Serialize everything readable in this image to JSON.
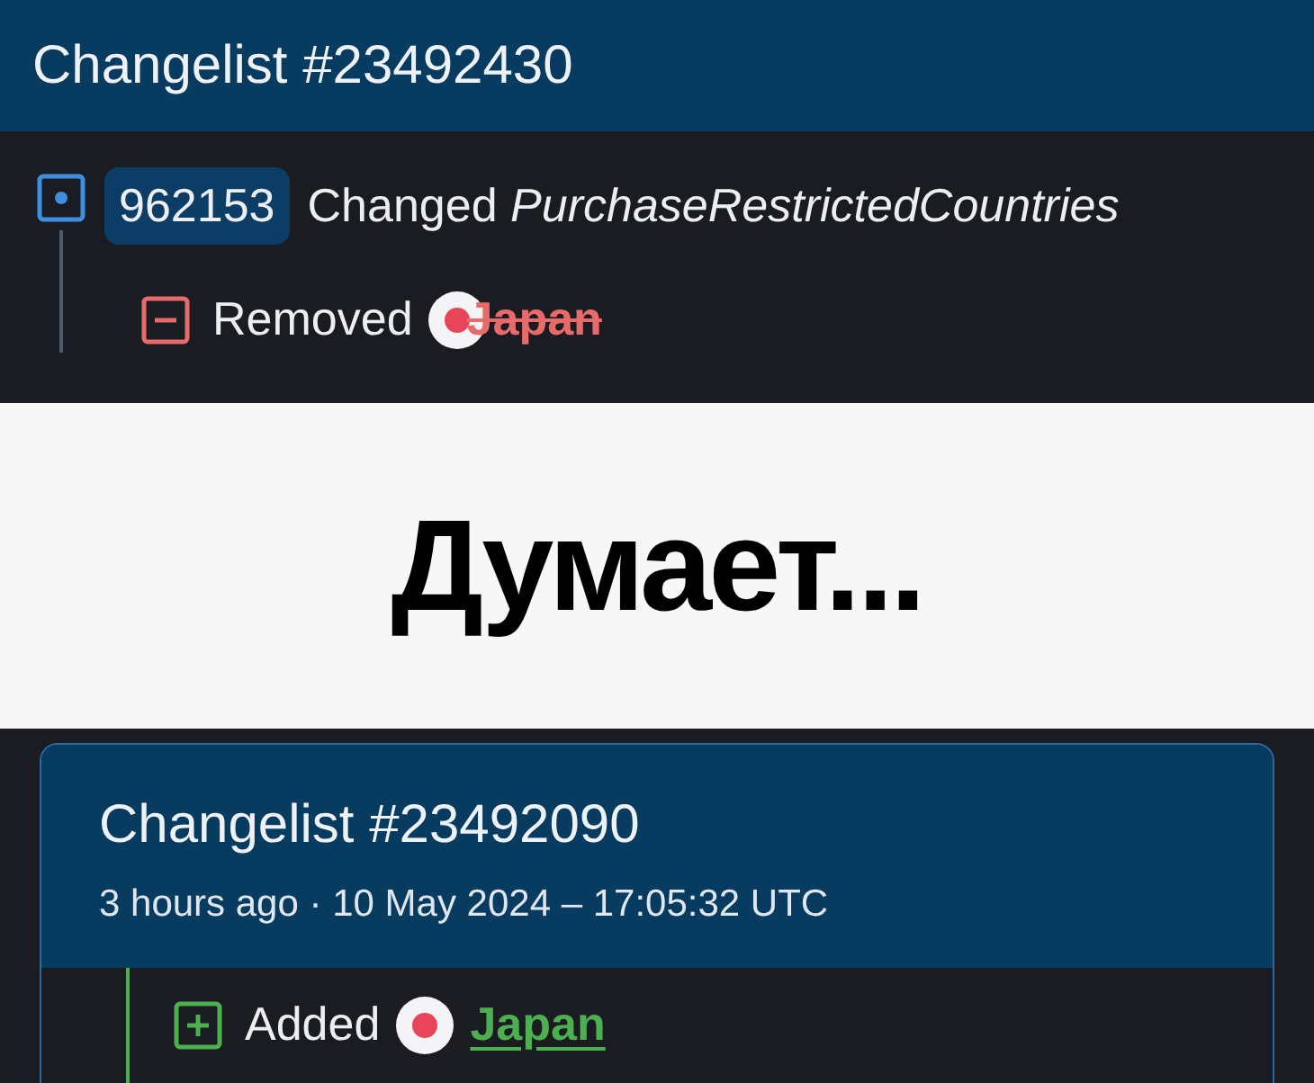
{
  "top_changelist": {
    "title": "Changelist #23492430",
    "change": {
      "id": "962153",
      "verb": "Changed",
      "field": "PurchaseRestrictedCountries"
    },
    "entries": [
      {
        "kind": "removed",
        "action": "Removed",
        "country": "Japan"
      }
    ]
  },
  "overlay": {
    "text": "Думает..."
  },
  "card": {
    "title": "Changelist #23492090",
    "meta": "3 hours ago · 10 May 2024 – 17:05:32 UTC",
    "entries": [
      {
        "kind": "added",
        "action": "Added",
        "country": "Japan"
      }
    ]
  }
}
